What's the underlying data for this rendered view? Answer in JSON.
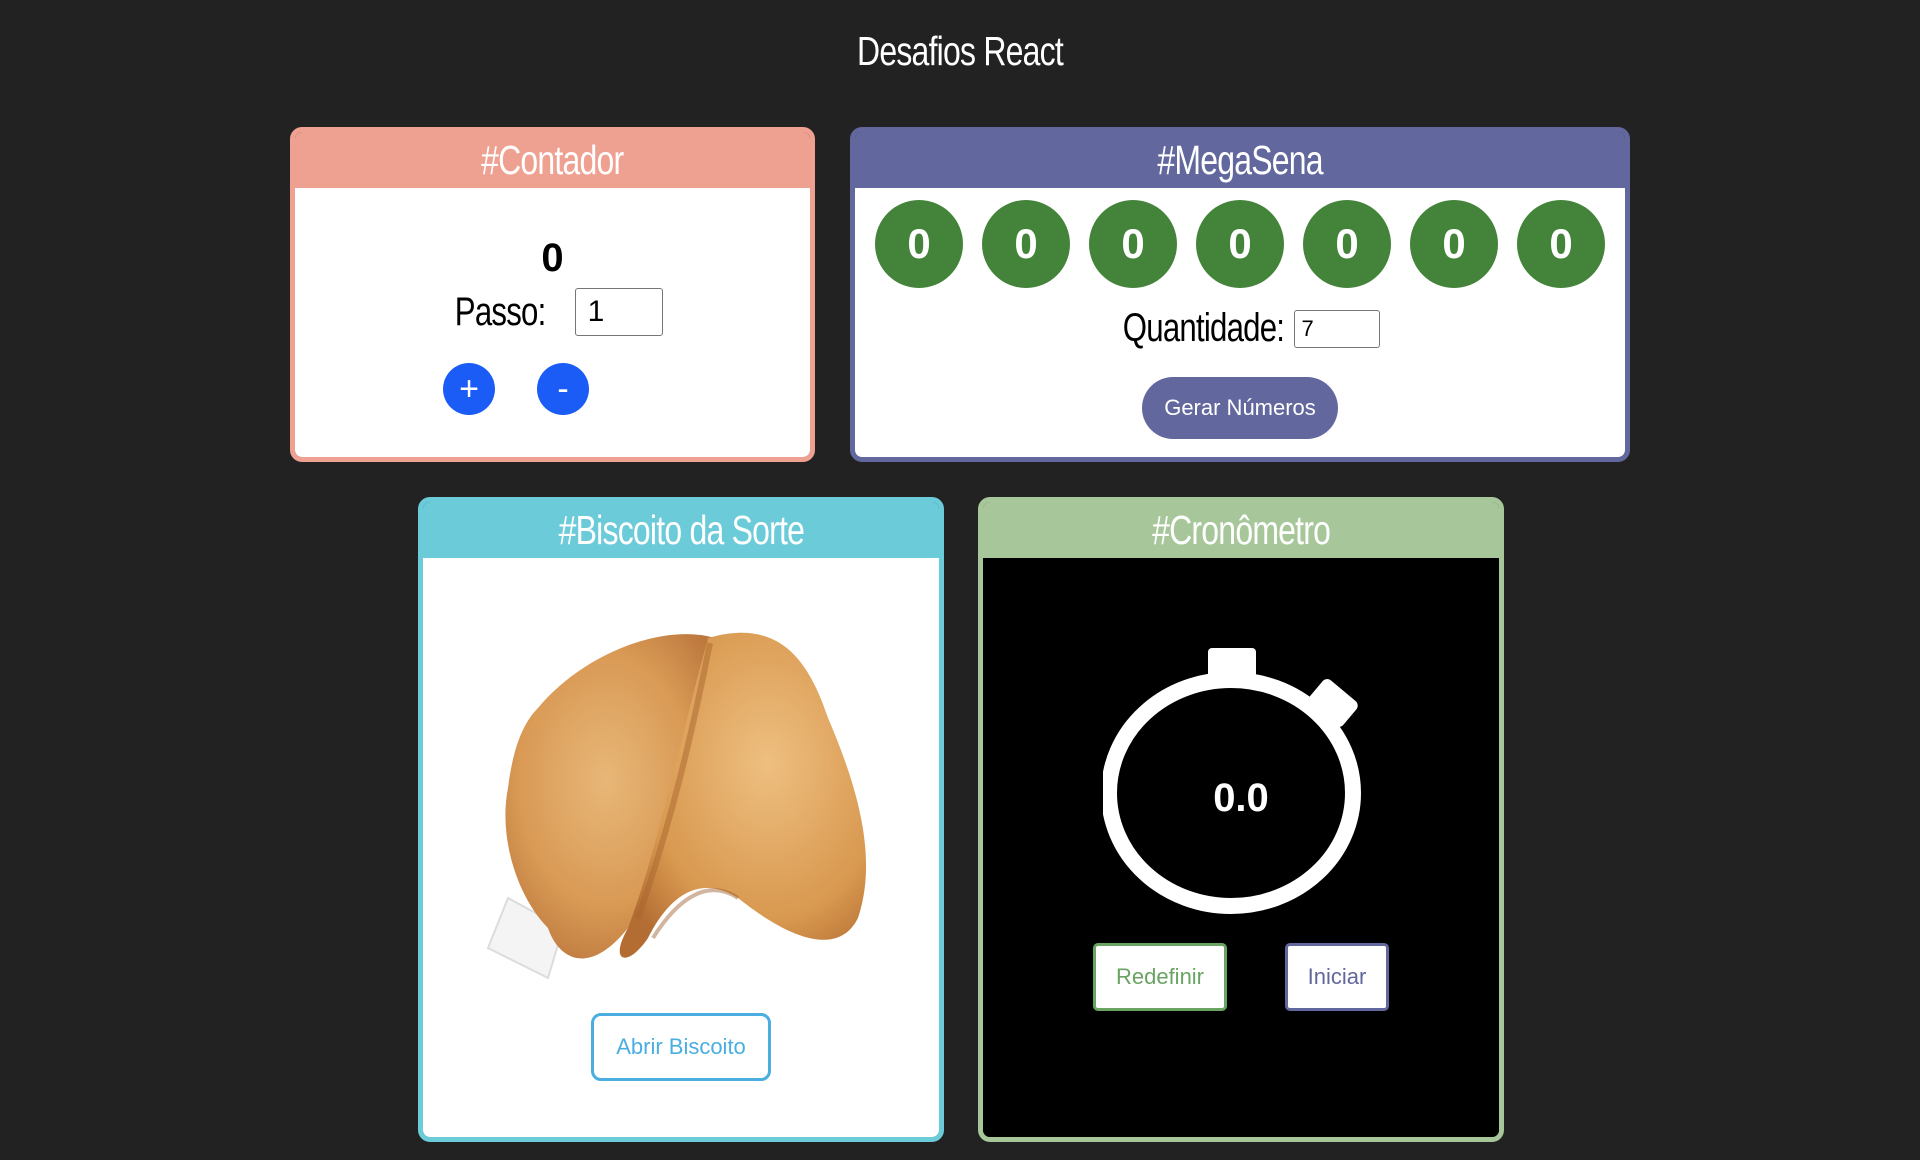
{
  "page": {
    "title": "Desafios React"
  },
  "contador": {
    "title": "#Contador",
    "value": "0",
    "step_label": "Passo:",
    "step_value": "1",
    "plus_label": "+",
    "minus_label": "-"
  },
  "megasena": {
    "title": "#MegaSena",
    "balls": [
      "0",
      "0",
      "0",
      "0",
      "0",
      "0",
      "0"
    ],
    "quantity_label": "Quantidade:",
    "quantity_value": "7",
    "generate_label": "Gerar Números"
  },
  "biscoito": {
    "title": "#Biscoito da Sorte",
    "image": "fortune-cookie",
    "open_label": "Abrir Biscoito"
  },
  "cronometro": {
    "title": "#Cronômetro",
    "time": "0.0",
    "icon": "stopwatch-icon",
    "reset_label": "Redefinir",
    "start_label": "Iniciar"
  },
  "colors": {
    "background": "#222222",
    "contador": "#eea091",
    "megasena": "#62689d",
    "biscoito": "#6bcbd8",
    "cronometro": "#a7c79b",
    "ball": "#44833a",
    "round_button": "#1a5cf5"
  }
}
